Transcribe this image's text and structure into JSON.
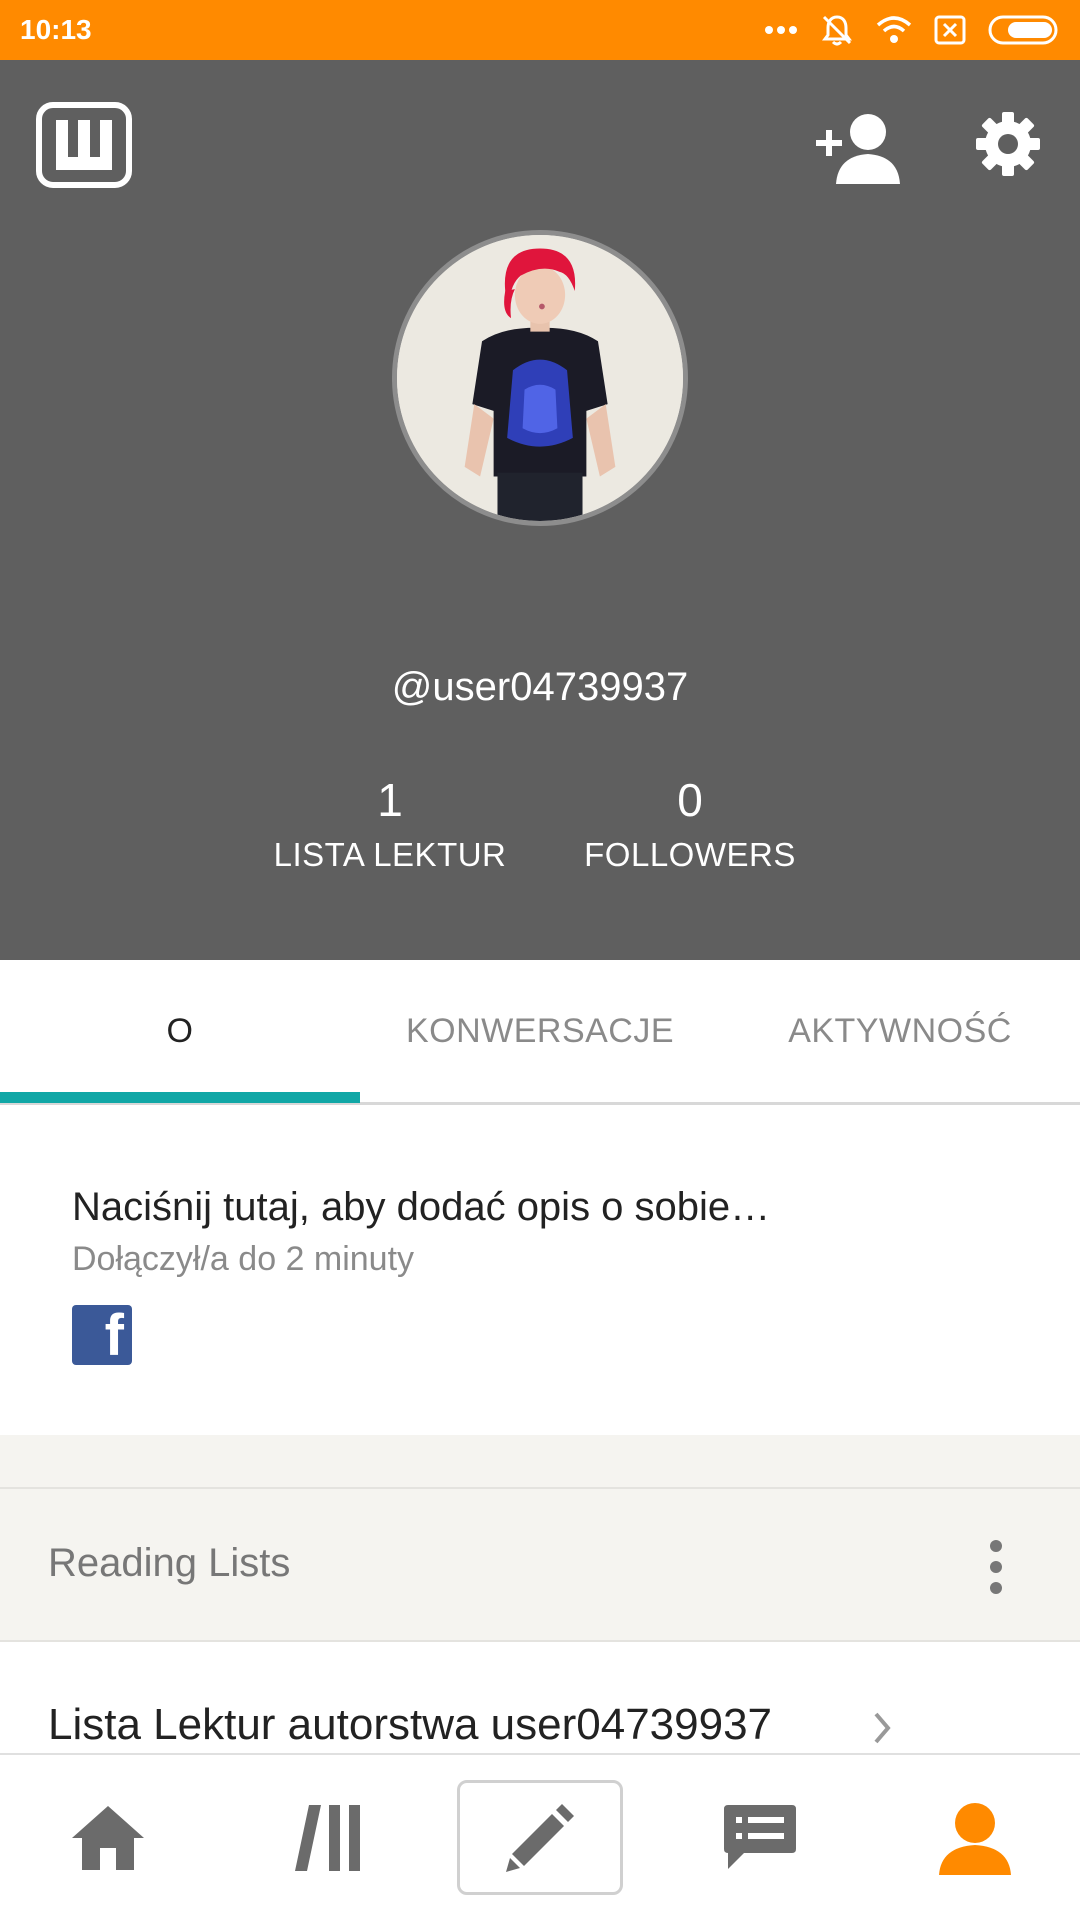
{
  "status_bar": {
    "time": "10:13"
  },
  "profile": {
    "username": "@user04739937",
    "stats": [
      {
        "count": "1",
        "label": "LISTA LEKTUR"
      },
      {
        "count": "0",
        "label": "FOLLOWERS"
      }
    ]
  },
  "tabs": [
    {
      "label": "O",
      "active": true
    },
    {
      "label": "KONWERSACJE",
      "active": false
    },
    {
      "label": "AKTYWNOŚĆ",
      "active": false
    }
  ],
  "about": {
    "prompt": "Naciśnij tutaj, aby dodać opis o sobie…",
    "joined": "Dołączył/a do 2 minuty"
  },
  "reading_lists": {
    "title": "Reading Lists",
    "items": [
      {
        "title": "Lista Lektur autorstwa user04739937"
      }
    ]
  },
  "bottom_nav": [
    "home-icon",
    "library-icon",
    "write-icon",
    "messages-icon",
    "profile-icon"
  ],
  "colors": {
    "status_bar": "#ff8a00",
    "header": "#5f5f5f",
    "tab_indicator": "#11a7a6",
    "active_nav": "#ff8a00",
    "nav_icon": "#6b6b6b",
    "facebook": "#3b5998"
  }
}
